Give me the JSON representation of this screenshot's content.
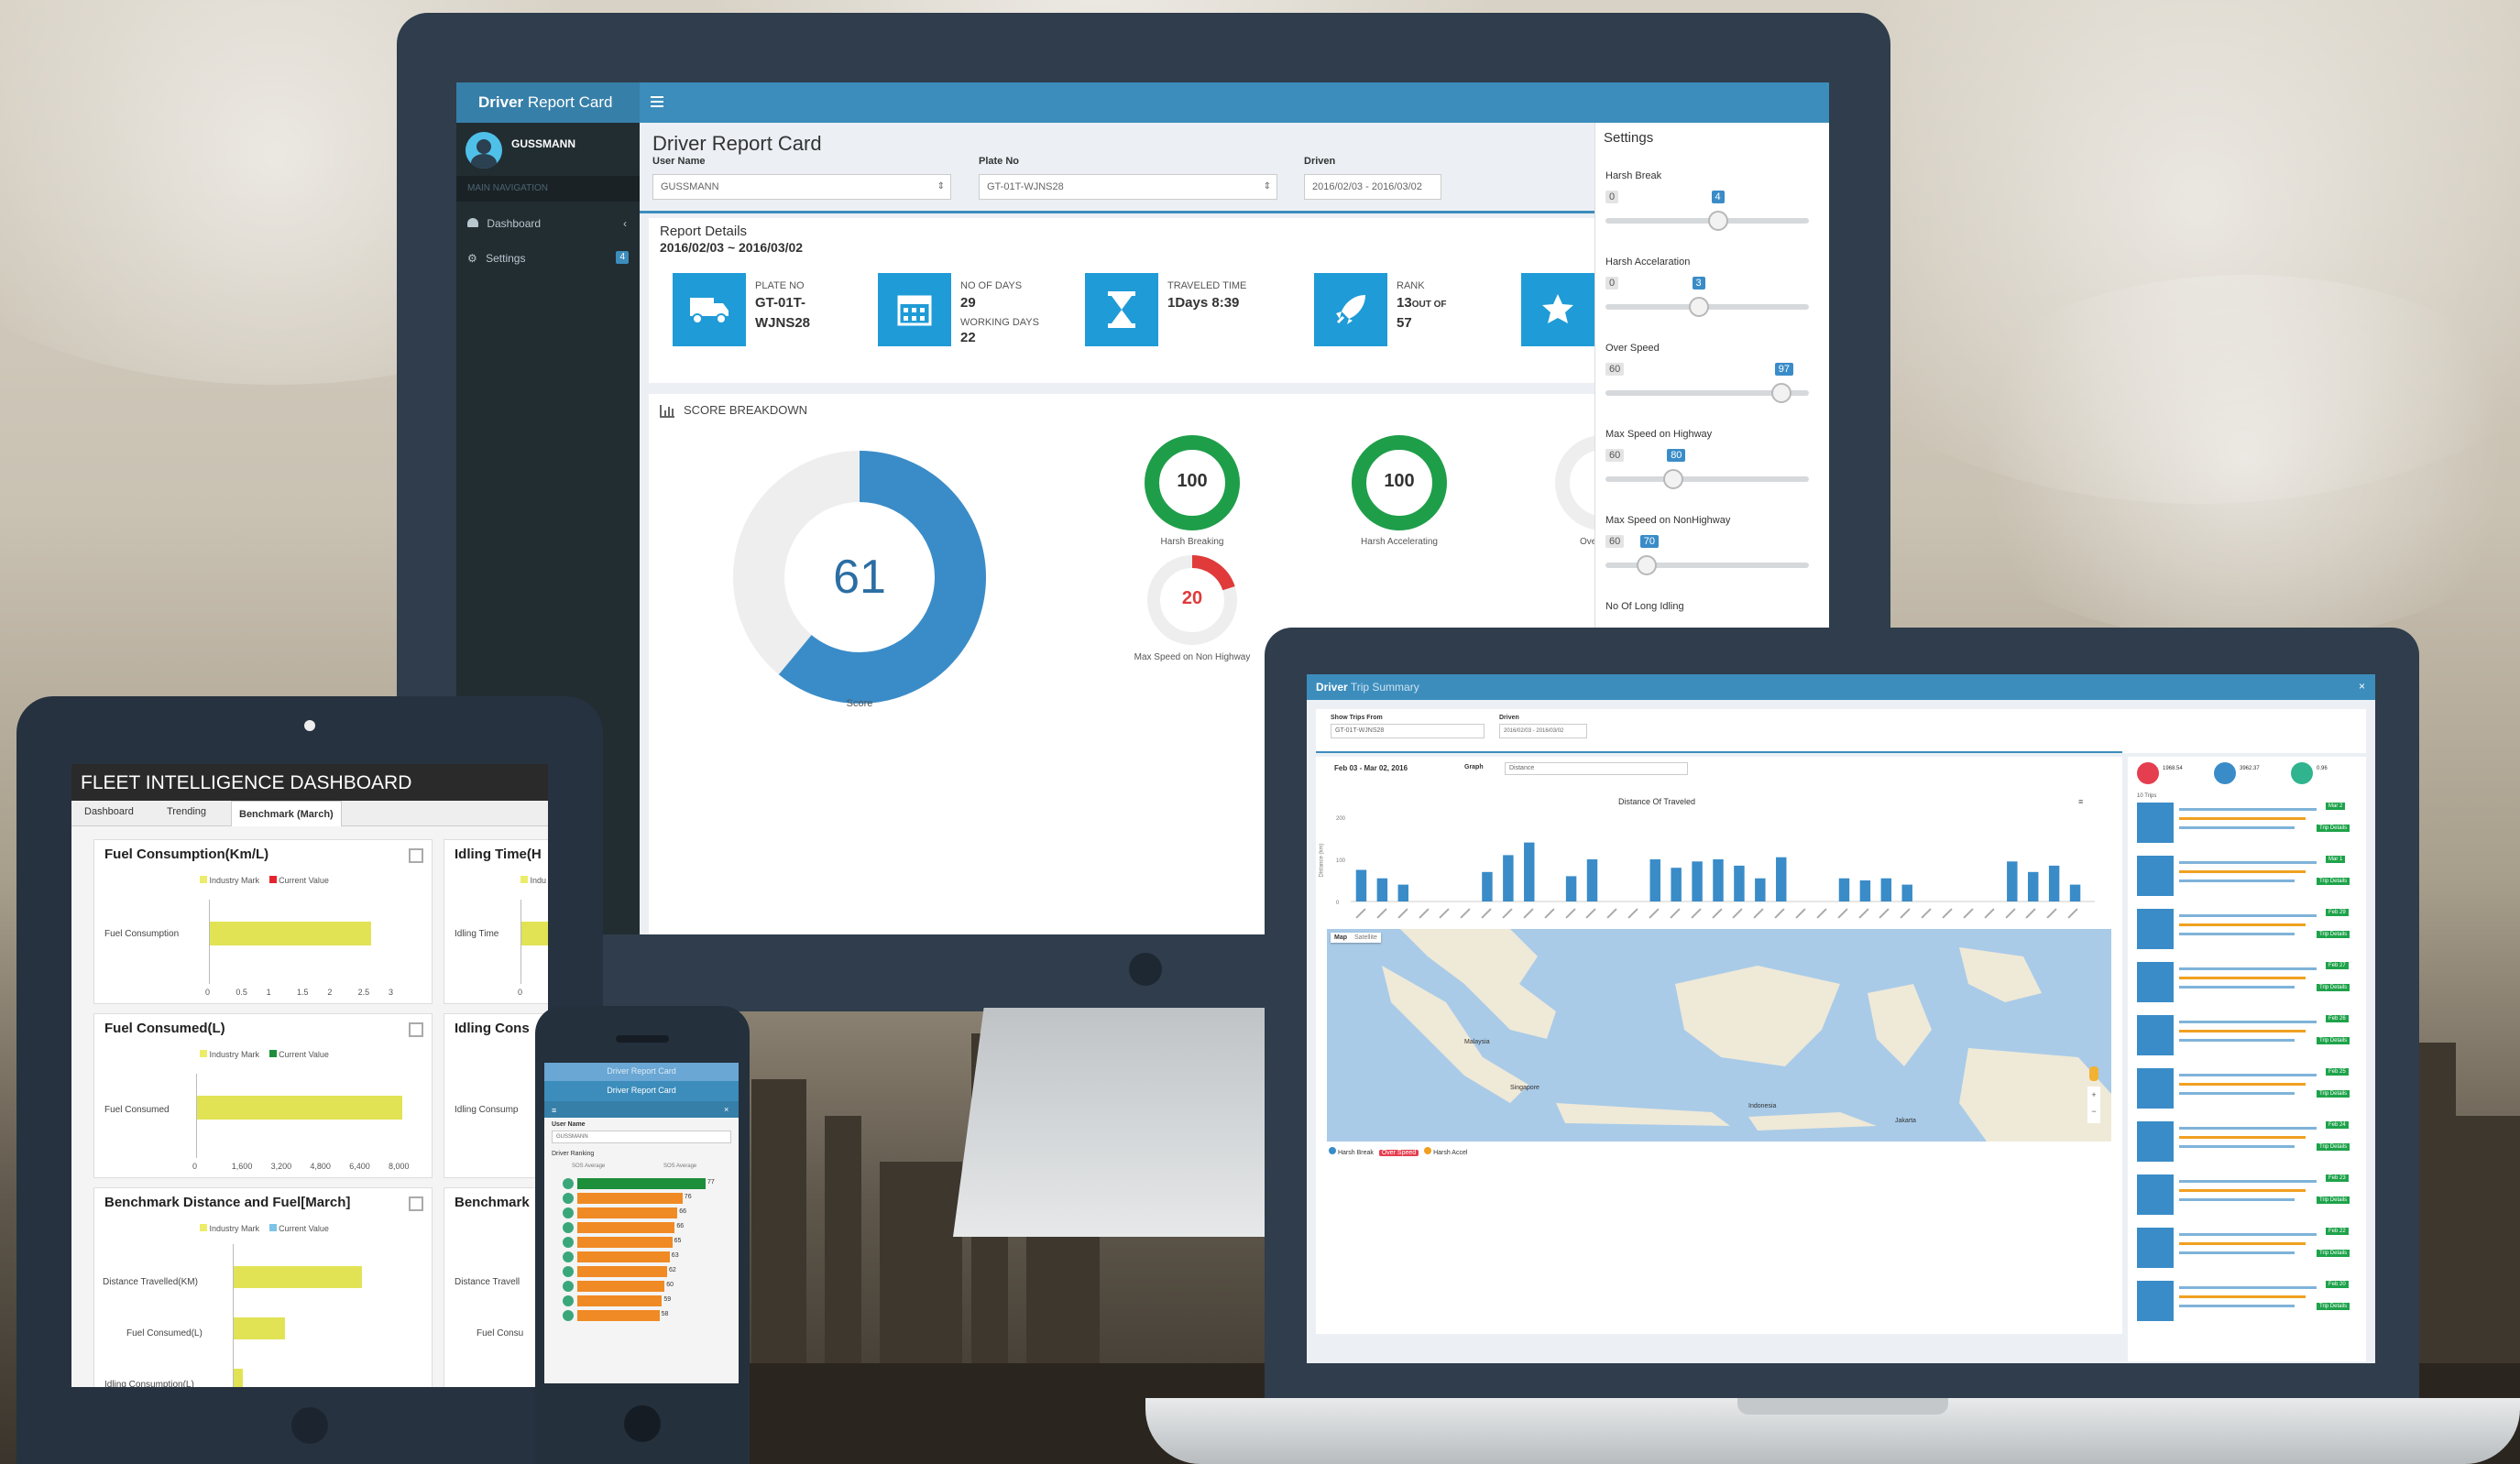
{
  "desktop": {
    "brand_bold": "Driver",
    "brand_light": "Report Card",
    "menu_icon": "hamburger-icon",
    "user_name": "GUSSMANN",
    "nav_header": "MAIN NAVIGATION",
    "nav": [
      {
        "label": "Dashboard",
        "icon": "dashboard-icon"
      },
      {
        "label": "Settings",
        "icon": "gears-icon",
        "badge": "4"
      }
    ],
    "title": "Driver Report Card",
    "filters": {
      "user_label": "User Name",
      "user_value": "GUSSMANN",
      "plate_label": "Plate No",
      "plate_value": "GT-01T-WJNS28",
      "driven_label": "Driven",
      "driven_value": "2016/02/03 - 2016/03/02"
    },
    "details_title": "Report Details",
    "details_range": "2016/02/03 ~ 2016/03/02",
    "stats": [
      {
        "label": "PLATE NO",
        "value": "GT-01T-WJNS28",
        "value1": "GT-01T-",
        "value2": "WJNS28",
        "icon": "truck-icon"
      },
      {
        "label": "NO OF DAYS",
        "value": "29",
        "label2": "WORKING DAYS",
        "value2": "22",
        "icon": "calendar-icon"
      },
      {
        "label": "TRAVELED TIME",
        "value": "1Days 8:39",
        "icon": "hourglass-icon"
      },
      {
        "label": "RANK",
        "value": "13",
        "suffix": "OUT OF",
        "value2": "57",
        "icon": "rocket-icon"
      },
      {
        "label": "",
        "value": "",
        "icon": "star-icon"
      }
    ],
    "score_header": "SCORE BREAKDOWN",
    "score": {
      "value": 61,
      "label": "Score"
    },
    "gauges": [
      {
        "value": 100,
        "label": "Harsh Breaking",
        "color": "#1e9e49"
      },
      {
        "value": 100,
        "label": "Harsh Accelerating",
        "color": "#1e9e49"
      },
      {
        "value": 20,
        "label": "Max Speed on Non Highway",
        "color": "#e03a3a"
      },
      {
        "label": "Ove"
      }
    ],
    "settings": {
      "title": "Settings",
      "items": [
        {
          "label": "Harsh Break",
          "min": "0",
          "value": "4",
          "level": 0.55
        },
        {
          "label": "Harsh Accelaration",
          "min": "0",
          "value": "3",
          "level": 0.45
        },
        {
          "label": "Over Speed",
          "min": "60",
          "value": "97",
          "level": 0.88
        },
        {
          "label": "Max Speed on Highway",
          "min": "60",
          "value": "80",
          "level": 0.32
        },
        {
          "label": "Max Speed on NonHighway",
          "min": "60",
          "value": "70",
          "level": 0.18
        },
        {
          "label": "No Of Long Idling",
          "min": "",
          "value": "",
          "level": 0.55
        }
      ]
    }
  },
  "tablet": {
    "title": "FLEET INTELLIGENCE DASHBOARD",
    "tabs": [
      "Dashboard",
      "Trending",
      "Benchmark (March)"
    ],
    "panels": [
      {
        "title": "Fuel Consumption(Km/L)",
        "legend": [
          "Industry Mark",
          "Current Value"
        ],
        "row": "Fuel Consumption",
        "ticks": [
          "0",
          "0.5",
          "1",
          "1.5",
          "2",
          "2.5",
          "3"
        ],
        "values": [
          2.45
        ]
      },
      {
        "title": "Fuel Consumed(L)",
        "legend": [
          "Industry Mark",
          "Current Value"
        ],
        "row": "Fuel Consumed",
        "ticks": [
          "0",
          "1,600",
          "3,200",
          "4,800",
          "6,400",
          "8,000"
        ],
        "values": [
          7900
        ]
      },
      {
        "title": "Benchmark Distance and Fuel[March]",
        "legend": [
          "Industry Mark",
          "Current Value"
        ],
        "rows": [
          "Distance Travelled(KM)",
          "Fuel Consumed(L)",
          "Idling Consumption(L)"
        ],
        "values": [
          0.55,
          0.22,
          0.04
        ]
      }
    ],
    "side_panels": [
      {
        "title": "Idling Time(H",
        "row": "Idling Time",
        "tick": "0",
        "legend": "Indu"
      },
      {
        "title": "Idling Cons",
        "row": "Idling Consump"
      },
      {
        "title": "Benchmark",
        "rows": [
          "Distance Travell",
          "Fuel Consu"
        ]
      }
    ]
  },
  "phone": {
    "header": "Driver Report Card",
    "title": "Driver Report Card",
    "field_label": "User Name",
    "field_value": "GUSSMANN",
    "section": "Driver Ranking",
    "col1": "SOS Average",
    "col2": "SOS Average",
    "bars": [
      {
        "value": 77,
        "level": 1.0
      },
      {
        "value": 76,
        "level": 0.82
      },
      {
        "value": 66,
        "level": 0.78
      },
      {
        "value": 66,
        "level": 0.76
      },
      {
        "value": 65,
        "level": 0.74
      },
      {
        "value": 63,
        "level": 0.72
      },
      {
        "value": 62,
        "level": 0.7
      },
      {
        "value": 60,
        "level": 0.68
      },
      {
        "value": 59,
        "level": 0.66
      },
      {
        "value": 58,
        "level": 0.64
      }
    ]
  },
  "laptop": {
    "brand_bold": "Driver",
    "brand_light": "Trip Summary",
    "plate_label": "Show Trips From",
    "plate_value": "GT-01T-WJNS28",
    "driven_label": "Driven",
    "driven_value": "2016/02/03 - 2016/03/02",
    "range": "Feb 03 - Mar 02, 2016",
    "graph_label": "Graph",
    "graph_value": "Distance",
    "chart_title": "Distance Of Traveled",
    "map_tabs": [
      "Map",
      "Satellite"
    ],
    "map_places": [
      "Malaysia",
      "Singapore",
      "Indonesia",
      "Jakarta"
    ],
    "legend": [
      "Harsh Break",
      "Over Speed",
      "Harsh Accel"
    ],
    "summary": [
      {
        "value": "1968.54",
        "color": "#e53e4f",
        "icon": "car-icon"
      },
      {
        "value": "3962.37",
        "color": "#3a8cc8",
        "icon": "hourglass-icon"
      },
      {
        "value": "0.96",
        "color": "#2fb48f",
        "icon": "fuel-icon"
      }
    ],
    "trips_count": "10 Trips",
    "trip_btn": "Trip Details",
    "trip_badges": [
      "Mar 2",
      "Mar 1",
      "Feb 29",
      "Feb 27",
      "Feb 26",
      "Feb 25",
      "Feb 24",
      "Feb 23",
      "Feb 22",
      "Feb 20"
    ]
  },
  "chart_data": {
    "type": "bar",
    "title": "Distance Of Traveled",
    "ylabel": "Distance (km)",
    "ylim": [
      0,
      200
    ],
    "values": [
      75,
      55,
      40,
      0,
      0,
      0,
      70,
      110,
      140,
      0,
      60,
      100,
      0,
      0,
      100,
      80,
      95,
      100,
      85,
      55,
      105,
      0,
      0,
      55,
      50,
      55,
      40,
      0,
      0,
      0,
      0,
      95,
      70,
      85,
      40
    ]
  }
}
